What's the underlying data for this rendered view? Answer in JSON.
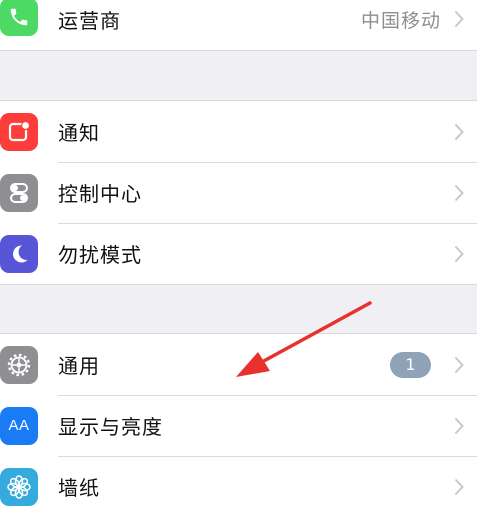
{
  "settings": {
    "carrier": {
      "label": "运营商",
      "value": "中国移动",
      "icon": "phone-icon",
      "color": "#4cd964"
    },
    "notifications": {
      "label": "通知",
      "icon": "notifications-icon",
      "color": "#fc3d39"
    },
    "control_center": {
      "label": "控制中心",
      "icon": "toggle-switches-icon",
      "color": "#8e8e93"
    },
    "do_not_disturb": {
      "label": "勿扰模式",
      "icon": "moon-icon",
      "color": "#5856d6"
    },
    "general": {
      "label": "通用",
      "badge": "1",
      "icon": "gear-icon",
      "color": "#8e8e93"
    },
    "display_brightness": {
      "label": "显示与亮度",
      "icon": "aa-text-icon",
      "icon_text": "AA",
      "color": "#1a7cf5"
    },
    "wallpaper": {
      "label": "墙纸",
      "icon": "flower-icon",
      "color": "#35aadc"
    }
  },
  "annotation": {
    "icon": "red-arrow-icon",
    "color": "#e8302d"
  }
}
